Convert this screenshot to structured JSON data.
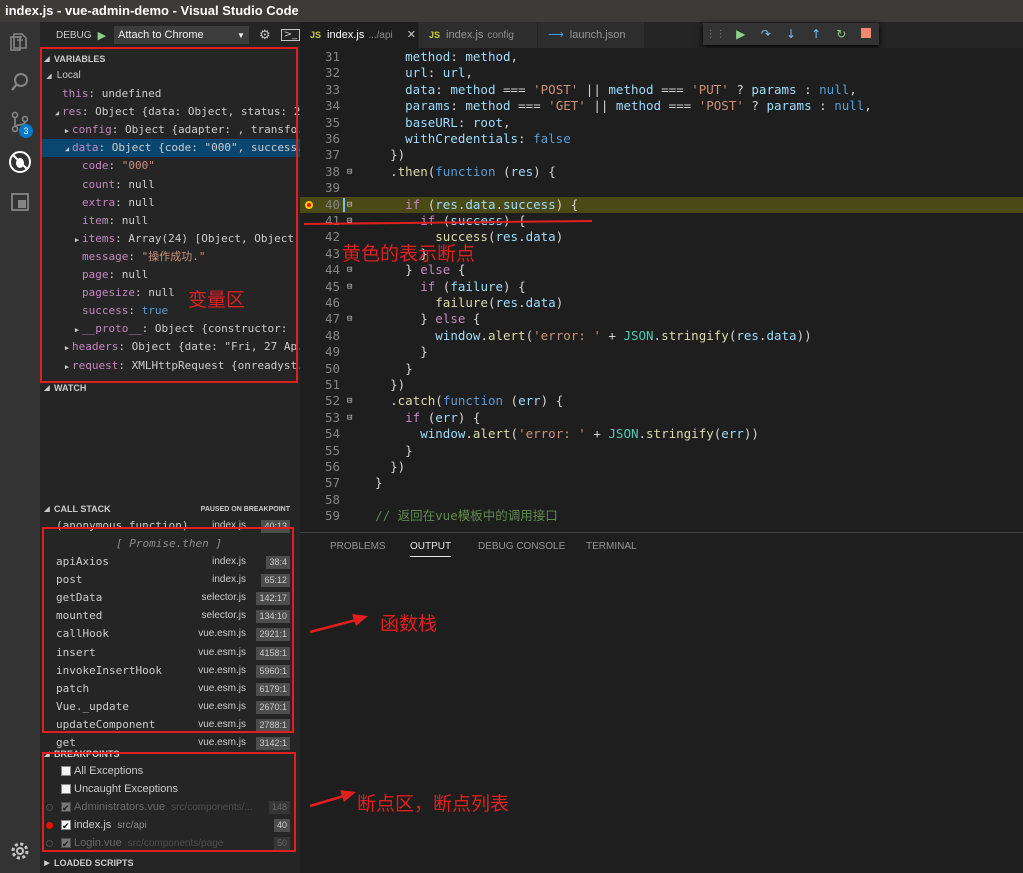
{
  "window": {
    "title": "index.js - vue-admin-demo - Visual Studio Code"
  },
  "activity": {
    "items": [
      "explorer-icon",
      "search-icon",
      "source-control-icon",
      "debug-icon",
      "extensions-icon"
    ],
    "scm_badge": "3",
    "settings": "gear-icon"
  },
  "debug": {
    "label": "DEBUG",
    "config": "Attach to Chrome"
  },
  "variables": {
    "header": "VARIABLES",
    "scope": "Local",
    "rows": [
      {
        "indent": 0,
        "tw": "",
        "name": "this",
        "value": "undefined",
        "vclass": "v"
      },
      {
        "indent": 0,
        "tw": "◢",
        "name": "res",
        "value": "Object {data: Object, status: 2",
        "vclass": "v"
      },
      {
        "indent": 1,
        "tw": "▶",
        "name": "config",
        "value": "Object {adapter: , transfo...",
        "vclass": "v"
      },
      {
        "indent": 1,
        "tw": "◢",
        "name": "data",
        "value": "Object {code: \"000\", success...",
        "vclass": "v",
        "selected": true
      },
      {
        "indent": 2,
        "tw": "",
        "name": "code",
        "value": "\"000\"",
        "vclass": "s"
      },
      {
        "indent": 2,
        "tw": "",
        "name": "count",
        "value": "null",
        "vclass": "v"
      },
      {
        "indent": 2,
        "tw": "",
        "name": "extra",
        "value": "null",
        "vclass": "v"
      },
      {
        "indent": 2,
        "tw": "",
        "name": "item",
        "value": "null",
        "vclass": "v"
      },
      {
        "indent": 2,
        "tw": "▶",
        "name": "items",
        "value": "Array(24) [Object, Object,",
        "vclass": "v"
      },
      {
        "indent": 2,
        "tw": "",
        "name": "message",
        "value": "\"操作成功.\"",
        "vclass": "s"
      },
      {
        "indent": 2,
        "tw": "",
        "name": "page",
        "value": "null",
        "vclass": "v"
      },
      {
        "indent": 2,
        "tw": "",
        "name": "pagesize",
        "value": "null",
        "vclass": "v"
      },
      {
        "indent": 2,
        "tw": "",
        "name": "success",
        "value": "true",
        "vclass": "b"
      },
      {
        "indent": 2,
        "tw": "▶",
        "name": "__proto__",
        "value": "Object {constructor: ,",
        "vclass": "v"
      },
      {
        "indent": 1,
        "tw": "▶",
        "name": "headers",
        "value": "Object {date: \"Fri, 27 Ap...",
        "vclass": "v"
      },
      {
        "indent": 1,
        "tw": "▶",
        "name": "request",
        "value": "XMLHttpRequest {onreadyst...",
        "vclass": "v"
      }
    ]
  },
  "watch": {
    "header": "WATCH"
  },
  "callstack": {
    "header": "CALL STACK",
    "status": "PAUSED ON BREAKPOINT",
    "top": {
      "fn": "(anonymous function)",
      "file": "index.js",
      "pos": "40:13"
    },
    "separator": "[ Promise.then ]",
    "frames": [
      {
        "fn": "apiAxios",
        "file": "index.js",
        "pos": "38:4"
      },
      {
        "fn": "post",
        "file": "index.js",
        "pos": "65:12"
      },
      {
        "fn": "getData",
        "file": "selector.js",
        "pos": "142:17"
      },
      {
        "fn": "mounted",
        "file": "selector.js",
        "pos": "134:10"
      },
      {
        "fn": "callHook",
        "file": "vue.esm.js",
        "pos": "2921:1"
      },
      {
        "fn": "insert",
        "file": "vue.esm.js",
        "pos": "4158:1"
      },
      {
        "fn": "invokeInsertHook",
        "file": "vue.esm.js",
        "pos": "5960:1"
      },
      {
        "fn": "patch",
        "file": "vue.esm.js",
        "pos": "6179:1"
      },
      {
        "fn": "Vue._update",
        "file": "vue.esm.js",
        "pos": "2670:1"
      },
      {
        "fn": "updateComponent",
        "file": "vue.esm.js",
        "pos": "2788:1"
      },
      {
        "fn": "get",
        "file": "vue.esm.js",
        "pos": "3142:1"
      }
    ]
  },
  "breakpoints": {
    "header": "BREAKPOINTS",
    "items": [
      {
        "label": "All Exceptions",
        "path": "",
        "line": "",
        "checked": false,
        "dot": "none",
        "dim": false
      },
      {
        "label": "Uncaught Exceptions",
        "path": "",
        "line": "",
        "checked": false,
        "dot": "none",
        "dim": false
      },
      {
        "label": "Administrators.vue",
        "path": "src/components/...",
        "line": "148",
        "checked": true,
        "dot": "hollow",
        "dim": true
      },
      {
        "label": "index.js",
        "path": "src/api",
        "line": "40",
        "checked": true,
        "dot": "#e51400",
        "dim": false
      },
      {
        "label": "Login.vue",
        "path": "src/components/page",
        "line": "50",
        "checked": true,
        "dot": "hollow",
        "dim": true
      }
    ]
  },
  "loaded_scripts": {
    "header": "LOADED SCRIPTS"
  },
  "tabs": [
    {
      "name": "index.js",
      "desc": ".../api",
      "active": true,
      "kind": "JS"
    },
    {
      "name": "index.js",
      "desc": "config",
      "active": false,
      "kind": "JS"
    },
    {
      "name": "launch.json",
      "desc": "",
      "active": false,
      "kind": "vscode"
    }
  ],
  "toolbar": [
    "drag-handle-icon",
    "continue-icon",
    "step-over-icon",
    "step-into-icon",
    "step-out-icon",
    "restart-icon",
    "stop-icon"
  ],
  "editor": {
    "current_line": 40,
    "lines": [
      {
        "n": "31",
        "fold": "",
        "t": "      <p>method</p>: <p>method</p>,"
      },
      {
        "n": "32",
        "fold": "",
        "t": "      <p>url</p>: <p>url</p>,"
      },
      {
        "n": "33",
        "fold": "",
        "t": "      <p>data</p>: <p>method</p> === <s>'POST'</s> || <p>method</p> === <s>'PUT'</s> ? <p>params</p> : <k>null</k>,"
      },
      {
        "n": "34",
        "fold": "",
        "t": "      <p>params</p>: <p>method</p> === <s>'GET'</s> || <p>method</p> === <s>'POST'</s> ? <p>params</p> : <k>null</k>,"
      },
      {
        "n": "35",
        "fold": "",
        "t": "      <p>baseURL</p>: <p>root</p>,"
      },
      {
        "n": "36",
        "fold": "",
        "t": "      <p>withCredentials</p>: <k>false</k>"
      },
      {
        "n": "37",
        "fold": "",
        "t": "    })"
      },
      {
        "n": "38",
        "fold": "⊟",
        "t": "    .<f>then</f>(<k>function</k> (<p>res</p>) {"
      },
      {
        "n": "39",
        "fold": "",
        "t": ""
      },
      {
        "n": "40",
        "fold": "⊟",
        "t": "      <c>if</c> (<p>res</p>.<p>data</p>.<p>success</p>) {"
      },
      {
        "n": "41",
        "fold": "⊟",
        "t": "        <c>if</c> (<p>success</p>) {"
      },
      {
        "n": "42",
        "fold": "",
        "t": "          <f>success</f>(<p>res</p>.<p>data</p>)"
      },
      {
        "n": "43",
        "fold": "",
        "t": "        }"
      },
      {
        "n": "44",
        "fold": "⊟",
        "t": "      } <c>else</c> {"
      },
      {
        "n": "45",
        "fold": "⊟",
        "t": "        <c>if</c> (<p>failure</p>) {"
      },
      {
        "n": "46",
        "fold": "",
        "t": "          <f>failure</f>(<p>res</p>.<p>data</p>)"
      },
      {
        "n": "47",
        "fold": "⊟",
        "t": "        } <c>else</c> {"
      },
      {
        "n": "48",
        "fold": "",
        "t": "          <p>window</p>.<f>alert</f>(<s>'error: '</s> + <t>JSON</t>.<f>stringify</f>(<p>res</p>.<p>data</p>))"
      },
      {
        "n": "49",
        "fold": "",
        "t": "        }"
      },
      {
        "n": "50",
        "fold": "",
        "t": "      }"
      },
      {
        "n": "51",
        "fold": "",
        "t": "    })"
      },
      {
        "n": "52",
        "fold": "⊟",
        "t": "    .<f>catch</f>(<k>function</k> (<p>err</p>) {"
      },
      {
        "n": "53",
        "fold": "⊟",
        "t": "      <c>if</c> (<p>err</p>) {"
      },
      {
        "n": "54",
        "fold": "",
        "t": "        <p>window</p>.<f>alert</f>(<s>'error: '</s> + <t>JSON</t>.<f>stringify</f>(<p>err</p>))"
      },
      {
        "n": "55",
        "fold": "",
        "t": "      }"
      },
      {
        "n": "56",
        "fold": "",
        "t": "    })"
      },
      {
        "n": "57",
        "fold": "",
        "t": "  }"
      },
      {
        "n": "58",
        "fold": "",
        "t": ""
      },
      {
        "n": "59",
        "fold": "",
        "t": "  <m>// 返回在vue模板中的调用接口</m>"
      }
    ]
  },
  "panel": {
    "tabs": [
      {
        "label": "PROBLEMS",
        "active": false
      },
      {
        "label": "OUTPUT",
        "active": true
      },
      {
        "label": "DEBUG CONSOLE",
        "active": false
      },
      {
        "label": "TERMINAL",
        "active": false
      }
    ]
  },
  "annotations": {
    "breakpoint_note": "黄色的表示断点",
    "variables_note": "变量区",
    "callstack_note": "函数栈",
    "breakpoints_note": "断点区，断点列表",
    "color": "#e01f1f"
  }
}
